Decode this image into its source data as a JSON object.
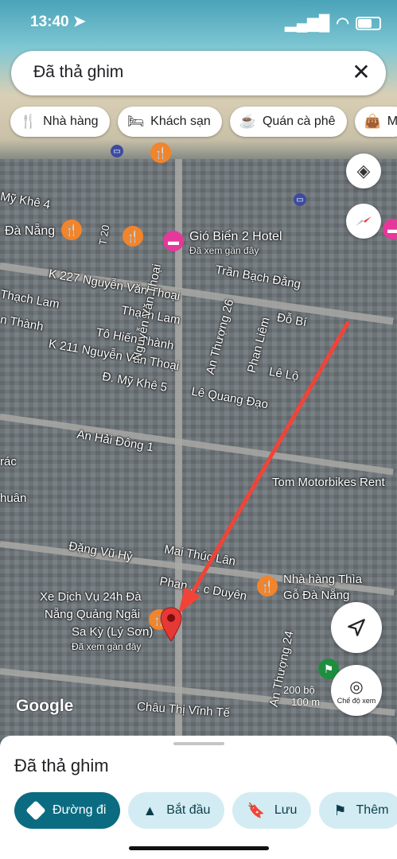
{
  "status_bar": {
    "time": "13:40"
  },
  "search": {
    "value": "Đã thả ghim"
  },
  "chips": [
    {
      "label": "Nhà hàng",
      "icon": "fork-knife-icon"
    },
    {
      "label": "Khách sạn",
      "icon": "bed-icon"
    },
    {
      "label": "Quán cà phê",
      "icon": "coffee-icon"
    },
    {
      "label": "M",
      "icon": "shopping-bag-icon"
    }
  ],
  "map_labels": {
    "my_khe_4": "Mỹ Khê 4",
    "da_nang": "Đà Nẵng",
    "t20": "T 20",
    "hotel_name": "Gió Biển 2 Hotel",
    "hotel_sub": "Đã xem gần đây",
    "tran_bach_dang": "Trần Bạch Đằng",
    "k227": "K 227 Nguyễn Văn Thoại",
    "thach_lam_left": "Thạch Lam",
    "thach_lam": "Thạch Lam",
    "n_thanh": "n Thành",
    "to_hien_thanh": "Tô Hiến Thành",
    "k211": "K 211 Nguyễn Văn Thoại",
    "nguyen_van_thoai": "Nguyễn Văn Thoại",
    "an_thuong_26": "An Thượng 26",
    "phan_liem": "Phan Liêm",
    "do_bi": "Đỗ Bí",
    "le_lo": "Lê Lộ",
    "my_khe_5": "Đ. Mỹ Khê 5",
    "le_quang_dao": "Lê Quang Đạo",
    "an_hai_dong_1": "An Hải Đông 1",
    "rac": "rác",
    "huan": "huân",
    "tom_motorbikes": "Tom Motorbikes Rent",
    "dang_vu_hy": "Đặng Vũ Hỷ",
    "mai_thuc_lan": "Mai Thúc Lân",
    "phan_duc_duyen": "Phan ... c Duyên",
    "nha_hang_thia": "Nhà hàng Thìa",
    "go_da_nang": "Gỗ Đà Nẵng",
    "xe_dich_vu_1": "Xe Dịch Vụ 24h Đà",
    "xe_dich_vu_2": "Nẵng Quảng Ngãi",
    "xe_dich_vu_3": "Sa Kỳ (Lý Sơn)",
    "xe_dich_vu_sub": "Đã xem gần đây",
    "an_thuong_24": "An Thượng 24",
    "chau_thi_vinh_te": "Châu Thị Vĩnh Tế",
    "google": "Google",
    "scale_ft": "200 bộ",
    "scale_m": "100 m",
    "street_view": "Chế độ xem"
  },
  "sheet": {
    "title": "Đã thả ghim",
    "actions": [
      {
        "label": "Đường đi",
        "icon": "directions-icon"
      },
      {
        "label": "Bắt đầu",
        "icon": "navigation-arrow-icon"
      },
      {
        "label": "Lưu",
        "icon": "bookmark-icon"
      },
      {
        "label": "Thêm",
        "icon": "flag-icon"
      }
    ]
  },
  "colors": {
    "primary": "#0b6b80",
    "tonal": "#d3ecf3",
    "pin": "#e53935",
    "annotation_arrow": "#f04438"
  }
}
